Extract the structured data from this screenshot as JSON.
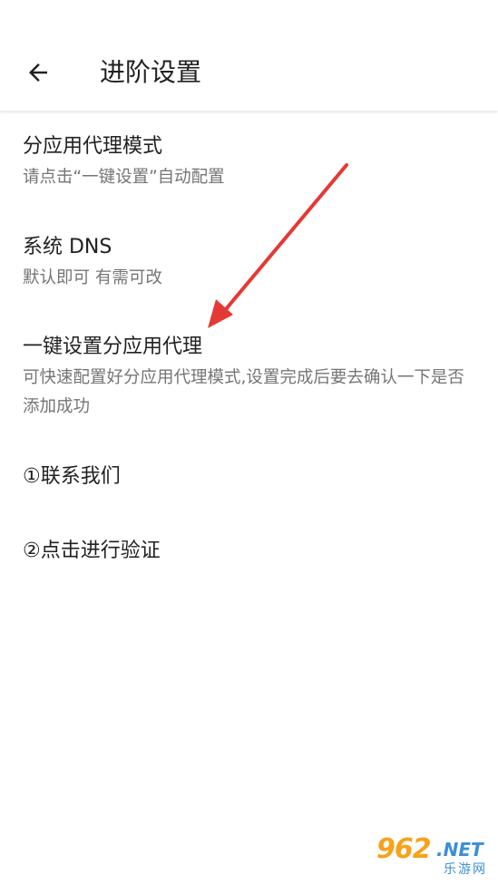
{
  "header": {
    "back_icon": "arrow-left-icon",
    "title": "进阶设置"
  },
  "items": [
    {
      "title": "分应用代理模式",
      "summary": "请点击“一键设置”自动配置"
    },
    {
      "title": "系统 DNS",
      "summary": "默认即可 有需可改"
    },
    {
      "title": "一键设置分应用代理",
      "summary": "可快速配置好分应用代理模式,设置完成后要去确认一下是否添加成功"
    },
    {
      "title": "①联系我们"
    },
    {
      "title": "②点击进行验证"
    }
  ],
  "annotation": {
    "arrow_color": "#e53935"
  },
  "watermark": {
    "main": "962",
    "domain": ".NET",
    "sub": "乐游网"
  },
  "colors": {
    "primary_text": "#212121",
    "secondary_text": "#757575",
    "background": "#ffffff"
  }
}
